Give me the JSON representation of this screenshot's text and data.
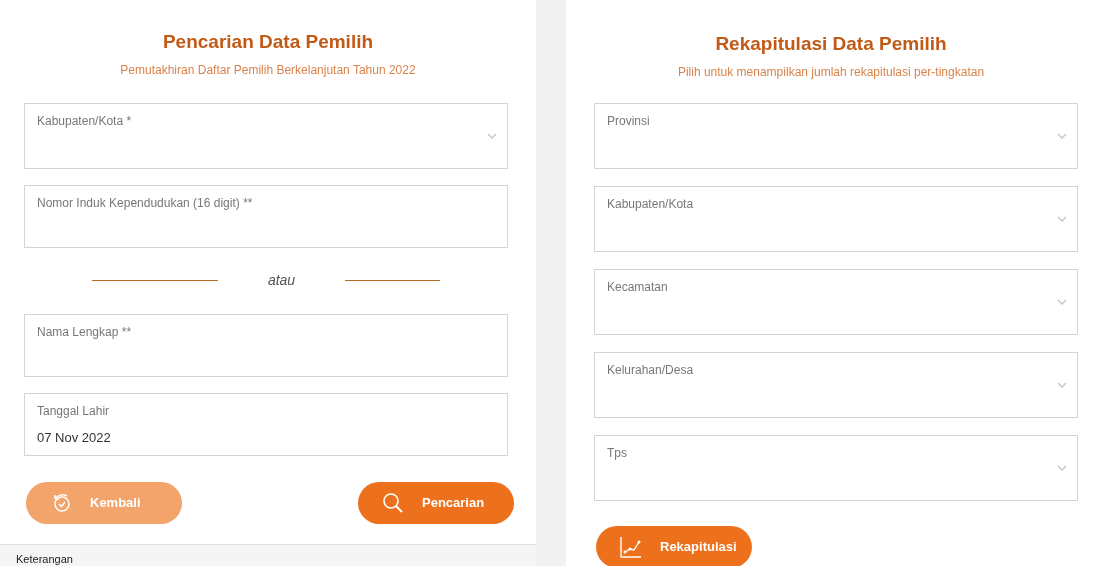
{
  "search_panel": {
    "title": "Pencarian Data Pemilih",
    "subtitle": "Pemutakhiran Daftar Pemilih Berkelanjutan Tahun 2022",
    "fields": [
      {
        "kind": "select",
        "label": "Kabupaten/Kota *"
      },
      {
        "kind": "text",
        "label": "Nomor Induk Kependudukan (16 digit) **"
      },
      {
        "kind": "divider",
        "label": "atau"
      },
      {
        "kind": "text",
        "label": "Nama Lengkap **"
      },
      {
        "kind": "text",
        "label": "Tanggal Lahir",
        "value": "07 Nov 2022"
      }
    ],
    "buttons": [
      {
        "kind": "back",
        "label": "Kembali"
      },
      {
        "kind": "search",
        "label": "Pencarian"
      }
    ],
    "footer": {
      "title": "Keterangan"
    }
  },
  "recap_panel": {
    "title": "Rekapitulasi Data Pemilih",
    "subtitle": "Pilih untuk menampilkan jumlah rekapitulasi per-tingkatan",
    "fields": [
      {
        "kind": "select",
        "label": "Provinsi"
      },
      {
        "kind": "select",
        "label": "Kabupaten/Kota"
      },
      {
        "kind": "select",
        "label": "Kecamatan"
      },
      {
        "kind": "select",
        "label": "Kelurahan/Desa"
      },
      {
        "kind": "select",
        "label": "Tps"
      }
    ],
    "buttons": [
      {
        "kind": "chart",
        "label": "Rekapitulasi"
      }
    ]
  }
}
